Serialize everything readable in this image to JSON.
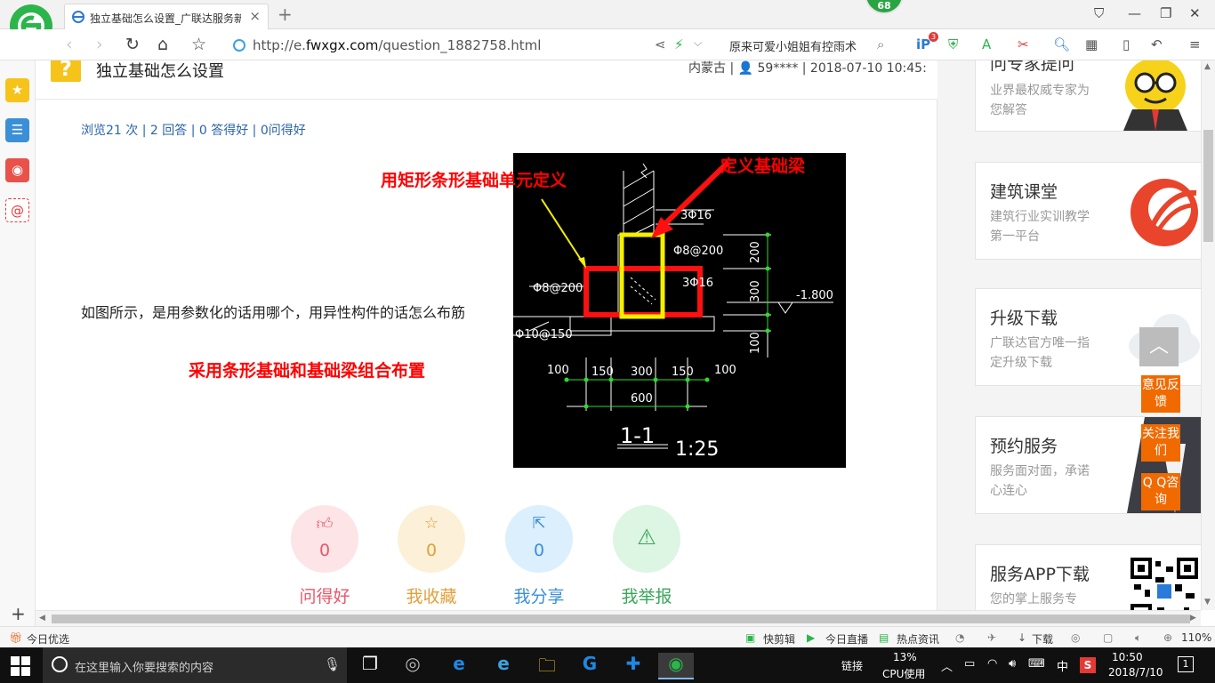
{
  "browser": {
    "tab_title": "独立基础怎么设置_广联达服务新",
    "tab_close": "×",
    "new_tab": "+",
    "badge": "68",
    "url_prefix": "http://e.",
    "url_domain": "fwxgx.com",
    "url_path": "/question_1882758.html",
    "search_text": "原来可爱小姐姐有控雨术",
    "ext_badge": "3"
  },
  "question": {
    "title": "独立基础怎么设置",
    "meta": "内蒙古 | 👤 59**** | 2018-07-10 10:45:",
    "stats": "浏览21 次 | 2 回答 | 0 答得好 | 0问得好",
    "body": "如图所示，是用参数化的话用哪个，用异性构件的话怎么布筋"
  },
  "annotations": {
    "rect_strip": "用矩形条形基础单元定义",
    "beam": "定义基础梁",
    "combo": "采用条形基础和基础梁组合布置"
  },
  "drawing": {
    "rebar_top": "3Φ16",
    "stirrup": "Φ8@200",
    "rebar_mid": "3Φ16",
    "left_rebar": "Φ8@200",
    "bottom_rebar": "Φ10@150",
    "elevation": "-1.800",
    "dim_200": "200",
    "dim_300": "300",
    "dim_100": "100",
    "dims_bottom": [
      "100",
      "150",
      "300",
      "150",
      "100"
    ],
    "dim_total": "600",
    "section_label": "1-1",
    "scale": "1:25"
  },
  "actions": [
    {
      "label": "问得好",
      "count": "0",
      "icon": "thumbs-up-icon",
      "bg": "#fde4e6",
      "fg": "#e8576a"
    },
    {
      "label": "我收藏",
      "count": "0",
      "icon": "star-icon",
      "bg": "#fdf0d8",
      "fg": "#e3a03a"
    },
    {
      "label": "我分享",
      "count": "0",
      "icon": "share-icon",
      "bg": "#dceffd",
      "fg": "#3b8fd6"
    },
    {
      "label": "我举报",
      "count": "0",
      "icon": "warning-icon",
      "bg": "#ddf5e3",
      "fg": "#3aa65a"
    }
  ],
  "right_cards": [
    {
      "title": "问专家提问",
      "sub": "业界最权威专家为您解答"
    },
    {
      "title": "建筑课堂",
      "sub": "建筑行业实训教学第一平台"
    },
    {
      "title": "升级下载",
      "sub": "广联达官方唯一指定升级下载"
    },
    {
      "title": "预约服务",
      "sub": "服务面对面，承诺心连心"
    },
    {
      "title": "服务APP下载",
      "sub": "您的掌上服务专"
    }
  ],
  "float_buttons": [
    "意见反馈",
    "关注我们",
    "Q Q咨询"
  ],
  "statusbar": {
    "left": "今日优选",
    "kuaijianji": "快剪辑",
    "live": "今日直播",
    "news": "热点资讯",
    "download": "下载",
    "zoom": "110%"
  },
  "taskbar": {
    "search_placeholder": "在这里输入你要搜索的内容",
    "link": "链接",
    "cpu_pct": "13%",
    "cpu_label": "CPU使用",
    "ime": "中",
    "time": "10:50",
    "date": "2018/7/10",
    "notif": "1"
  }
}
